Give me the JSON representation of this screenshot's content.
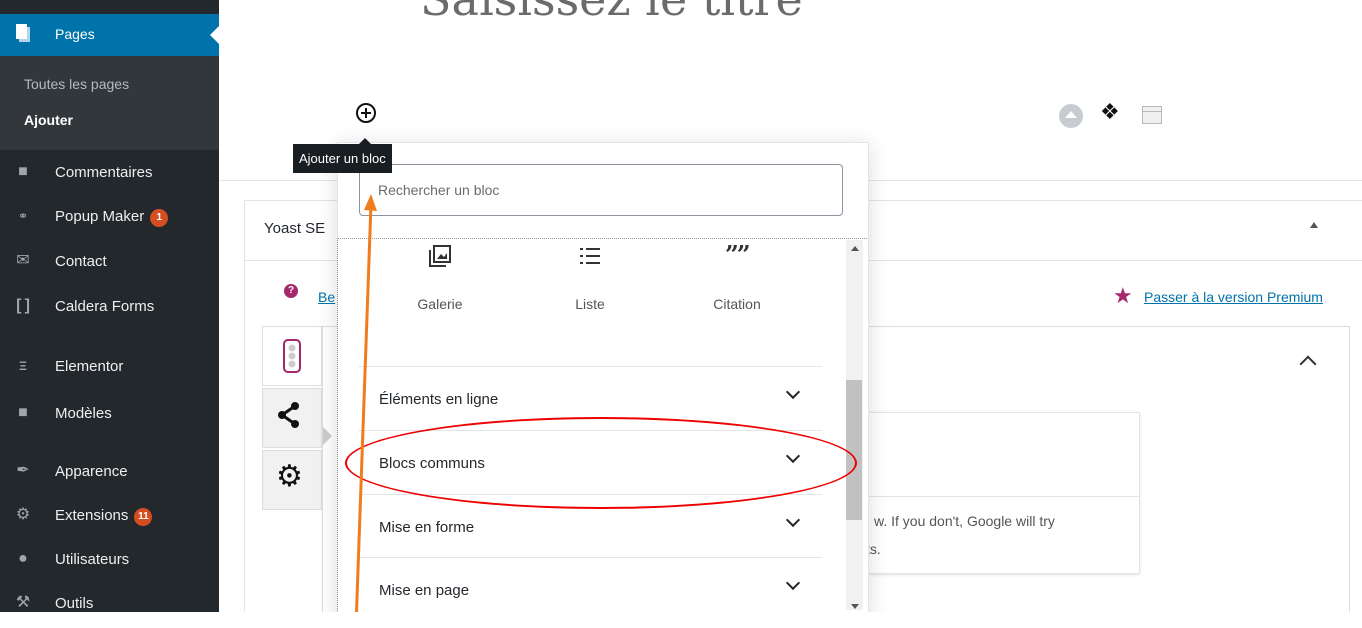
{
  "sidebar": {
    "active_item": {
      "label": "Pages",
      "icon": "page-icon"
    },
    "submenu": [
      {
        "label": "Toutes les pages"
      },
      {
        "label": "Ajouter"
      }
    ],
    "items": [
      {
        "label": "Commentaires",
        "icon": "comment-icon"
      },
      {
        "label": "Popup Maker",
        "icon": "popup-icon",
        "badge": "1"
      },
      {
        "label": "Contact",
        "icon": "mail-icon"
      },
      {
        "label": "Caldera Forms",
        "icon": "caldera-icon"
      },
      {
        "label": "Elementor",
        "icon": "elementor-icon"
      },
      {
        "label": "Modèles",
        "icon": "folder-icon"
      },
      {
        "label": "Apparence",
        "icon": "brush-icon"
      },
      {
        "label": "Extensions",
        "icon": "plug-icon",
        "badge": "11"
      },
      {
        "label": "Utilisateurs",
        "icon": "user-icon"
      },
      {
        "label": "Outils",
        "icon": "wrench-icon"
      }
    ]
  },
  "editor": {
    "title_placeholder": "Saisissez le titre",
    "add_block_tooltip": "Ajouter un bloc"
  },
  "inserter": {
    "search_placeholder": "Rechercher un bloc",
    "blocks": [
      {
        "label": "Galerie",
        "icon": "gallery-icon"
      },
      {
        "label": "Liste",
        "icon": "list-icon"
      },
      {
        "label": "Citation",
        "icon": "quote-icon"
      }
    ],
    "categories": [
      {
        "label": "Éléments en ligne"
      },
      {
        "label": "Blocs communs"
      },
      {
        "label": "Mise en forme"
      },
      {
        "label": "Mise en page"
      }
    ]
  },
  "yoast": {
    "title": "Yoast SE",
    "help_link": "Be",
    "premium_link": "Passer à la version Premium",
    "snippet_line1": "w. If you don't, Google will try",
    "snippet_line2": "ts."
  },
  "colors": {
    "sidebar_bg": "#23282d",
    "active_blue": "#0073aa",
    "annotation_red": "#e00000",
    "annotation_arrow": "#f07c1e",
    "yoast_purple": "#a4286a"
  }
}
